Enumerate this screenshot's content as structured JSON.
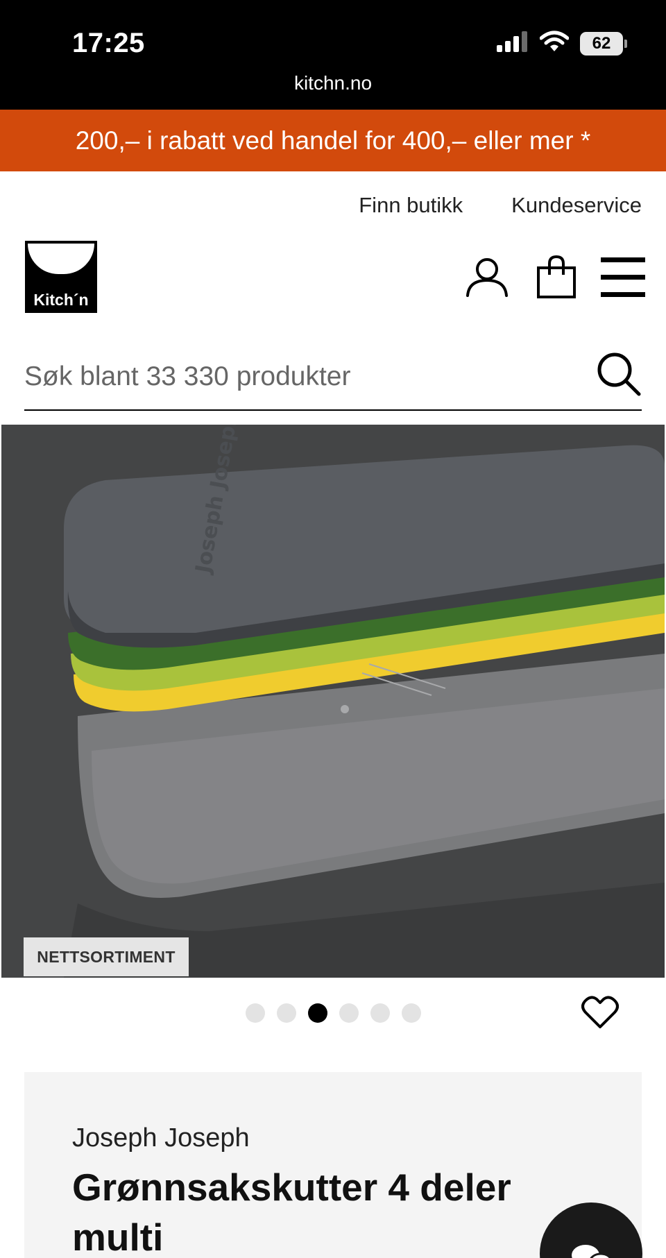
{
  "status_bar": {
    "time": "17:25",
    "battery": "62",
    "icons": [
      "signal-icon",
      "wifi-icon",
      "battery-icon"
    ]
  },
  "browser": {
    "url": "kitchn.no"
  },
  "promo": {
    "text": "200,– i rabatt ved handel for 400,– eller mer *",
    "color": "#d24a0c"
  },
  "header": {
    "links": [
      "Finn butikk",
      "Kundeservice"
    ],
    "logo_text": "Kitch´n",
    "icons": [
      "user-icon",
      "shopping-bag-icon",
      "menu-icon"
    ]
  },
  "search": {
    "placeholder": "Søk blant 33 330 produkter",
    "value": ""
  },
  "product": {
    "image_text": "Joseph Joseph",
    "badge": "NETTSORTIMENT",
    "carousel": {
      "count": 6,
      "active_index": 3
    },
    "brand": "Joseph Joseph",
    "title": "Grønnsakskutter 4 deler multi"
  },
  "colors": {
    "accent": "#d24a0c",
    "lid": "#55585e",
    "green_dark": "#3b6f2a",
    "green_light": "#a9c23c",
    "yellow": "#f0cc2e"
  }
}
